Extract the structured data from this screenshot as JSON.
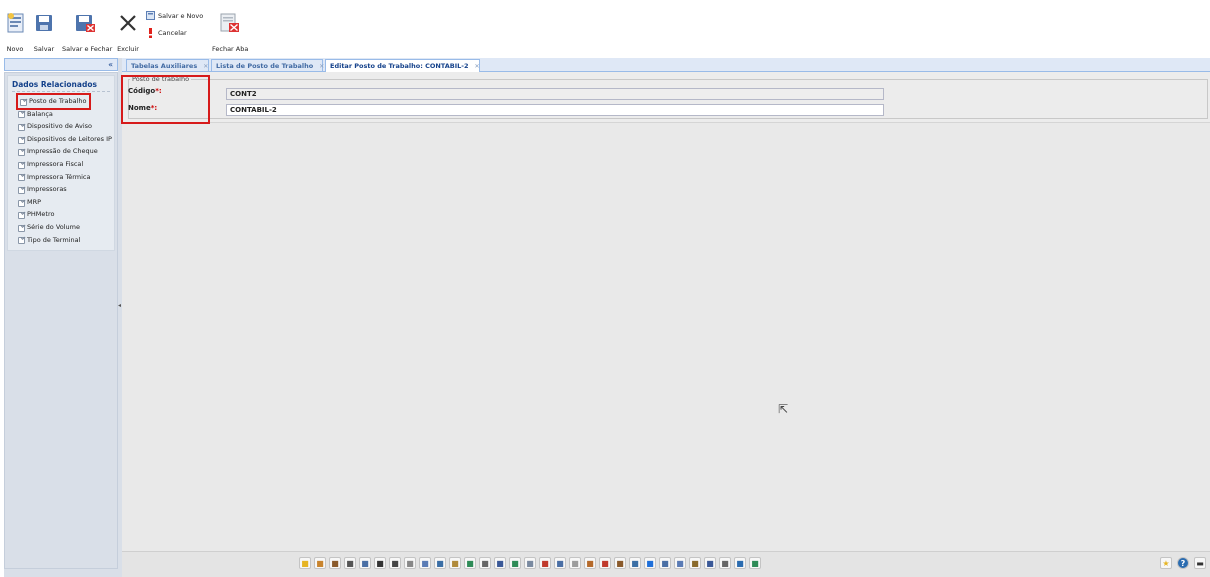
{
  "toolbar": {
    "novo": "Novo",
    "salvar": "Salvar",
    "salvar_fechar": "Salvar e Fechar",
    "excluir": "Excluir",
    "salvar_novo": "Salvar e Novo",
    "cancelar": "Cancelar",
    "fechar_aba": "Fechar Aba"
  },
  "sidebar": {
    "collapse": "«",
    "title": "Dados Relacionados",
    "items": [
      "Posto de Trabalho",
      "Balança",
      "Dispositivo de Aviso",
      "Dispositivos de Leitores IP",
      "Impressão de Cheque",
      "Impressora Fiscal",
      "Impressora Térmica",
      "Impressoras",
      "MRP",
      "PHMetro",
      "Série do Volume",
      "Tipo de Terminal"
    ]
  },
  "tabs": [
    {
      "label": "Tabelas Auxiliares",
      "close": "✕"
    },
    {
      "label": "Lista de Posto de Trabalho",
      "close": "✕"
    },
    {
      "label": "Editar Posto de Trabalho: CONTABIL-2",
      "close": "✕"
    }
  ],
  "form": {
    "legend": "Posto de trabalho",
    "codigo_label": "Código",
    "nome_label": "Nome",
    "required_mark": "*:",
    "codigo_value": "CONT2",
    "nome_value": "CONTABIL-2"
  },
  "dock_icons": [
    "star",
    "folder",
    "briefcase",
    "calculator",
    "window",
    "building",
    "circle",
    "pen",
    "printer",
    "grid",
    "house",
    "globe",
    "book",
    "arrows",
    "down",
    "tray",
    "factory",
    "shelf",
    "bottle",
    "card",
    "fruit",
    "drum",
    "box",
    "diamond",
    "chart",
    "docs",
    "machine",
    "cart",
    "abc",
    "refresh",
    "leaf"
  ],
  "dock_right": [
    "star-icon",
    "help-icon",
    "video-icon"
  ],
  "colors": {
    "accent": "#15428b",
    "tab_bg": "#dfe8f6",
    "highlight": "#d61a1a",
    "required": "#cc0000"
  }
}
